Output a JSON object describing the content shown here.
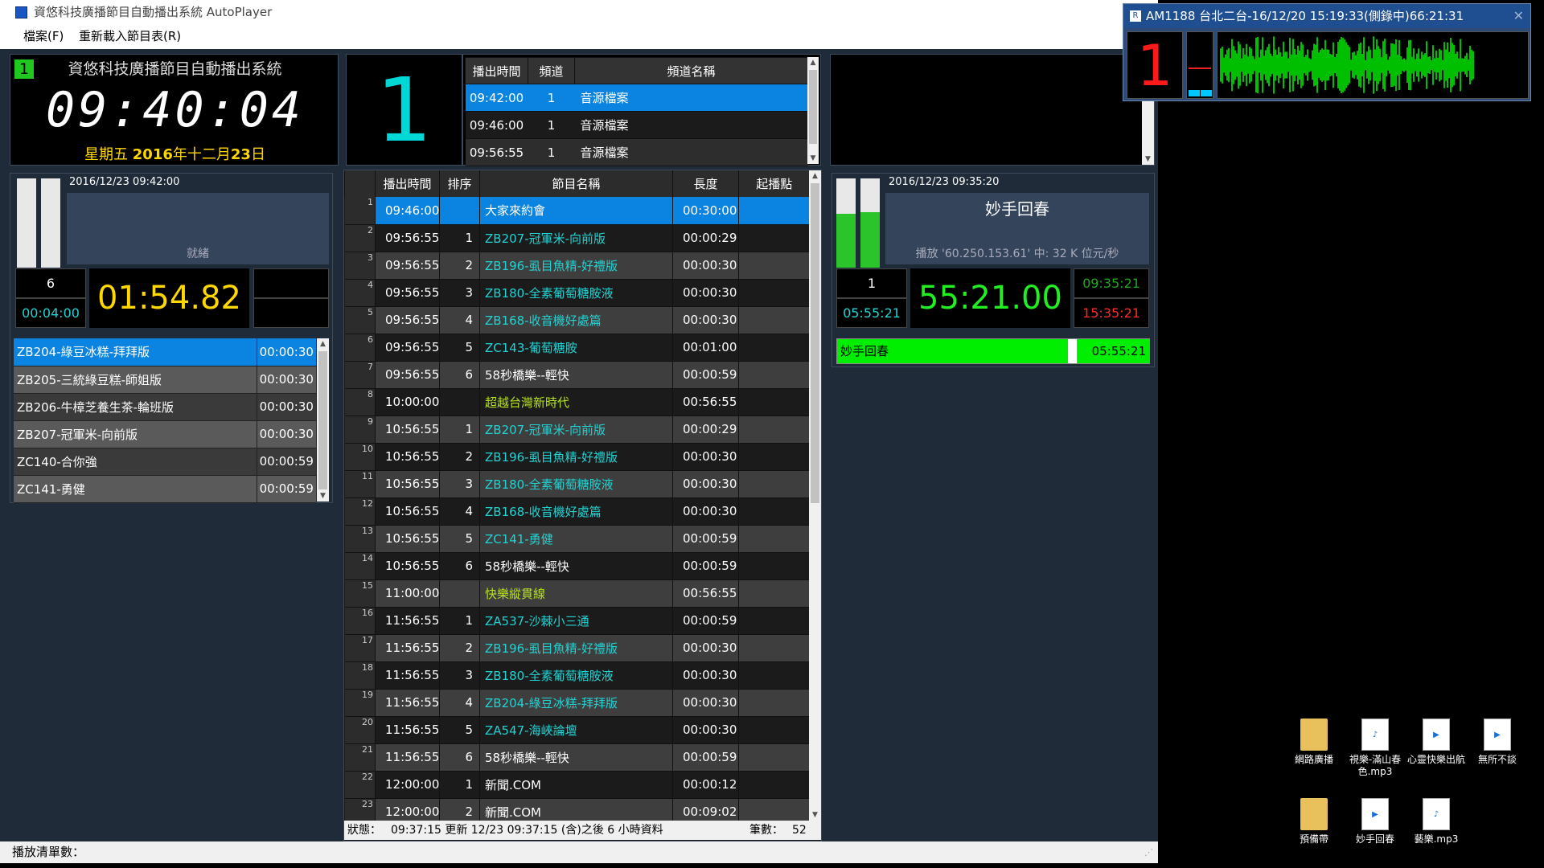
{
  "window": {
    "title": "資悠科技廣播節目自動播出系統 AutoPlayer",
    "menu": [
      "檔案(F)",
      "重新載入節目表(R)"
    ]
  },
  "clock": {
    "channel_badge": "1",
    "system_name": "資悠科技廣播節目自動播出系統",
    "time": "09:40:04",
    "date_prefix": "星期五 ",
    "date_bold": "2016",
    "date_mid": "年十二月",
    "date_day": "23",
    "date_suffix": "日"
  },
  "big_channel": "1",
  "channel_table": {
    "headers": [
      "播出時間",
      "頻道",
      "頻道名稱"
    ],
    "rows": [
      {
        "time": "09:42:00",
        "channel": "1",
        "name": "音源檔案"
      },
      {
        "time": "09:46:00",
        "channel": "1",
        "name": "音源檔案"
      },
      {
        "time": "09:56:55",
        "channel": "1",
        "name": "音源檔案"
      }
    ]
  },
  "left_player": {
    "timestamp": "2016/12/23 09:42:00",
    "status": "就緒",
    "count": "6",
    "total": "00:04:00",
    "countdown": "01:54.82",
    "queue": [
      {
        "name": "ZB204-綠豆冰糕-拜拜版",
        "dur": "00:00:30"
      },
      {
        "name": "ZB205-三統綠豆糕-師姐版",
        "dur": "00:00:30"
      },
      {
        "name": "ZB206-牛樟芝養生茶-輪班版",
        "dur": "00:00:30"
      },
      {
        "name": "ZB207-冠軍米-向前版",
        "dur": "00:00:30"
      },
      {
        "name": "ZC140-合你強",
        "dur": "00:00:59"
      },
      {
        "name": "ZC141-勇健",
        "dur": "00:00:59"
      }
    ]
  },
  "right_player": {
    "timestamp": "2016/12/23 09:35:20",
    "title": "妙手回春",
    "info": "播放 '60.250.153.61' 中: 32 K 位元/秒",
    "count": "1",
    "total": "05:55:21",
    "elapsed": "55:21.00",
    "start_time": "09:35:21",
    "end_time": "15:35:21",
    "vu_left": 0.6,
    "vu_right": 0.62,
    "bar_label": "妙手回春",
    "bar_time": "05:55:21",
    "progress": 0.74
  },
  "program_table": {
    "headers": [
      "播出時間",
      "排序",
      "節目名稱",
      "長度",
      "起播點"
    ],
    "rows": [
      {
        "idx": "1",
        "time": "09:46:00",
        "order": "",
        "name": "大家來約會",
        "dur": "00:30:00",
        "type": "selected"
      },
      {
        "idx": "2",
        "time": "09:56:55",
        "order": "1",
        "name": "ZB207-冠軍米-向前版",
        "dur": "00:00:29",
        "type": "ad"
      },
      {
        "idx": "3",
        "time": "09:56:55",
        "order": "2",
        "name": "ZB196-虱目魚精-好禮版",
        "dur": "00:00:30",
        "type": "ad"
      },
      {
        "idx": "4",
        "time": "09:56:55",
        "order": "3",
        "name": "ZB180-全素葡萄糖胺液",
        "dur": "00:00:30",
        "type": "ad"
      },
      {
        "idx": "5",
        "time": "09:56:55",
        "order": "4",
        "name": "ZB168-收音機好處篇",
        "dur": "00:00:30",
        "type": "ad"
      },
      {
        "idx": "6",
        "time": "09:56:55",
        "order": "5",
        "name": "ZC143-葡萄糖胺",
        "dur": "00:01:00",
        "type": "ad"
      },
      {
        "idx": "7",
        "time": "09:56:55",
        "order": "6",
        "name": "58秒橋樂--輕快",
        "dur": "00:00:59",
        "type": "plain"
      },
      {
        "idx": "8",
        "time": "10:00:00",
        "order": "",
        "name": "超越台灣新時代",
        "dur": "00:56:55",
        "type": "show"
      },
      {
        "idx": "9",
        "time": "10:56:55",
        "order": "1",
        "name": "ZB207-冠軍米-向前版",
        "dur": "00:00:29",
        "type": "ad"
      },
      {
        "idx": "10",
        "time": "10:56:55",
        "order": "2",
        "name": "ZB196-虱目魚精-好禮版",
        "dur": "00:00:30",
        "type": "ad"
      },
      {
        "idx": "11",
        "time": "10:56:55",
        "order": "3",
        "name": "ZB180-全素葡萄糖胺液",
        "dur": "00:00:30",
        "type": "ad"
      },
      {
        "idx": "12",
        "time": "10:56:55",
        "order": "4",
        "name": "ZB168-收音機好處篇",
        "dur": "00:00:30",
        "type": "ad"
      },
      {
        "idx": "13",
        "time": "10:56:55",
        "order": "5",
        "name": "ZC141-勇健",
        "dur": "00:00:59",
        "type": "ad"
      },
      {
        "idx": "14",
        "time": "10:56:55",
        "order": "6",
        "name": "58秒橋樂--輕快",
        "dur": "00:00:59",
        "type": "plain"
      },
      {
        "idx": "15",
        "time": "11:00:00",
        "order": "",
        "name": "快樂縱貫線",
        "dur": "00:56:55",
        "type": "show"
      },
      {
        "idx": "16",
        "time": "11:56:55",
        "order": "1",
        "name": "ZA537-沙棘小三通",
        "dur": "00:00:59",
        "type": "ad"
      },
      {
        "idx": "17",
        "time": "11:56:55",
        "order": "2",
        "name": "ZB196-虱目魚精-好禮版",
        "dur": "00:00:30",
        "type": "ad"
      },
      {
        "idx": "18",
        "time": "11:56:55",
        "order": "3",
        "name": "ZB180-全素葡萄糖胺液",
        "dur": "00:00:30",
        "type": "ad"
      },
      {
        "idx": "19",
        "time": "11:56:55",
        "order": "4",
        "name": "ZB204-綠豆冰糕-拜拜版",
        "dur": "00:00:30",
        "type": "ad"
      },
      {
        "idx": "20",
        "time": "11:56:55",
        "order": "5",
        "name": "ZA547-海峽論壇",
        "dur": "00:00:30",
        "type": "ad"
      },
      {
        "idx": "21",
        "time": "11:56:55",
        "order": "6",
        "name": "58秒橋樂--輕快",
        "dur": "00:00:59",
        "type": "plain"
      },
      {
        "idx": "22",
        "time": "12:00:00",
        "order": "1",
        "name": "新聞.COM",
        "dur": "00:00:12",
        "type": "plain"
      },
      {
        "idx": "23",
        "time": "12:00:00",
        "order": "2",
        "name": "新聞.COM",
        "dur": "00:09:02",
        "type": "plain"
      }
    ]
  },
  "program_status": {
    "label": "狀態：",
    "text": "09:37:15 更新 12/23 09:37:15 (含)之後 6 小時資料",
    "count_label": "筆數：",
    "count": "52"
  },
  "statusbar": "播放清單數：",
  "mini_window": {
    "title": "AM1188 台北二台-16/12/20 15:19:33(側錄中)66:21:31",
    "channel": "1"
  },
  "desktop_icons": [
    {
      "label": "網路廣播",
      "kind": "folder"
    },
    {
      "label": "視樂-滿山春色.mp3",
      "kind": "mp3"
    },
    {
      "label": "心靈快樂出航",
      "kind": "wma"
    },
    {
      "label": "無所不談",
      "kind": "wma"
    },
    {
      "label": "預備帶",
      "kind": "folder"
    },
    {
      "label": "妙手回春",
      "kind": "wma"
    },
    {
      "label": "藝樂.mp3",
      "kind": "mp3"
    }
  ],
  "colors": {
    "selected": "#0a84e0",
    "ad_text": "#22d3d3",
    "show_text": "#b6e31e",
    "green_bar": "#00ee00",
    "clock_yellow": "#ffd700",
    "elapsed_green": "#22ee22"
  }
}
